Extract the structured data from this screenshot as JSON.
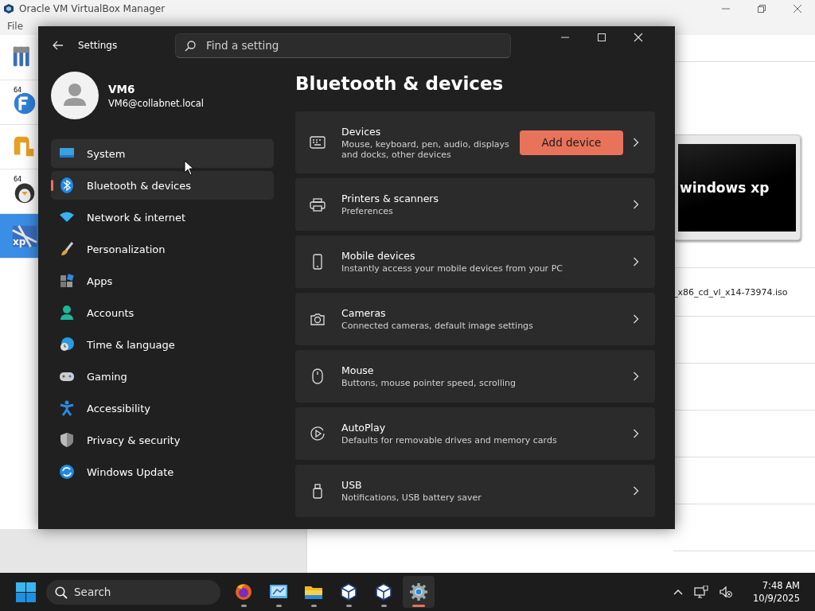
{
  "background_window": {
    "title": "Oracle VM VirtualBox Manager",
    "menu": [
      "File"
    ],
    "vm_list": [
      {
        "kind": "orb",
        "badge": "64",
        "selected": false
      },
      {
        "kind": "shape",
        "selected": false
      },
      {
        "kind": "penguin",
        "badge": "64",
        "selected": false
      },
      {
        "kind": "xp",
        "badge": "xp",
        "selected": true
      }
    ],
    "preview": {
      "caption": "windows xp"
    },
    "detail_text": "_x86_cd_vl_x14-73974.iso"
  },
  "settings": {
    "title": "Settings",
    "search": {
      "placeholder": "Find a setting"
    },
    "profile": {
      "name": "VM6",
      "email": "VM6@collabnet.local"
    },
    "nav": [
      {
        "label": "System",
        "kind": "system",
        "selected": false,
        "hovered": true
      },
      {
        "label": "Bluetooth & devices",
        "kind": "bluetooth",
        "selected": true,
        "hovered": false
      },
      {
        "label": "Network & internet",
        "kind": "wifi",
        "selected": false,
        "hovered": false
      },
      {
        "label": "Personalization",
        "kind": "brush",
        "selected": false,
        "hovered": false
      },
      {
        "label": "Apps",
        "kind": "apps",
        "selected": false,
        "hovered": false
      },
      {
        "label": "Accounts",
        "kind": "account",
        "selected": false,
        "hovered": false
      },
      {
        "label": "Time & language",
        "kind": "time",
        "selected": false,
        "hovered": false
      },
      {
        "label": "Gaming",
        "kind": "gamepad",
        "selected": false,
        "hovered": false
      },
      {
        "label": "Accessibility",
        "kind": "access",
        "selected": false,
        "hovered": false
      },
      {
        "label": "Privacy & security",
        "kind": "shield",
        "selected": false,
        "hovered": false
      },
      {
        "label": "Windows Update",
        "kind": "update",
        "selected": false,
        "hovered": false
      }
    ],
    "heading": "Bluetooth & devices",
    "cards": [
      {
        "kind": "keyboard",
        "title": "Devices",
        "subtitle": "Mouse, keyboard, pen, audio, displays and docks, other devices",
        "button": "Add device"
      },
      {
        "kind": "printer",
        "title": "Printers & scanners",
        "subtitle": "Preferences"
      },
      {
        "kind": "phone",
        "title": "Mobile devices",
        "subtitle": "Instantly access your mobile devices from your PC"
      },
      {
        "kind": "camera",
        "title": "Cameras",
        "subtitle": "Connected cameras, default image settings"
      },
      {
        "kind": "mouse",
        "title": "Mouse",
        "subtitle": "Buttons, mouse pointer speed, scrolling"
      },
      {
        "kind": "autoplay",
        "title": "AutoPlay",
        "subtitle": "Defaults for removable drives and memory cards"
      },
      {
        "kind": "usb",
        "title": "USB",
        "subtitle": "Notifications, USB battery saver"
      }
    ]
  },
  "taskbar": {
    "search": {
      "placeholder": "Search"
    },
    "apps": [
      {
        "kind": "firefox",
        "active": false
      },
      {
        "kind": "control",
        "active": false
      },
      {
        "kind": "folder",
        "active": false
      },
      {
        "kind": "cube",
        "active": false
      },
      {
        "kind": "cube",
        "active": false
      },
      {
        "kind": "gear",
        "active": true
      }
    ],
    "time": "7:48 AM",
    "date": "10/9/2025"
  }
}
